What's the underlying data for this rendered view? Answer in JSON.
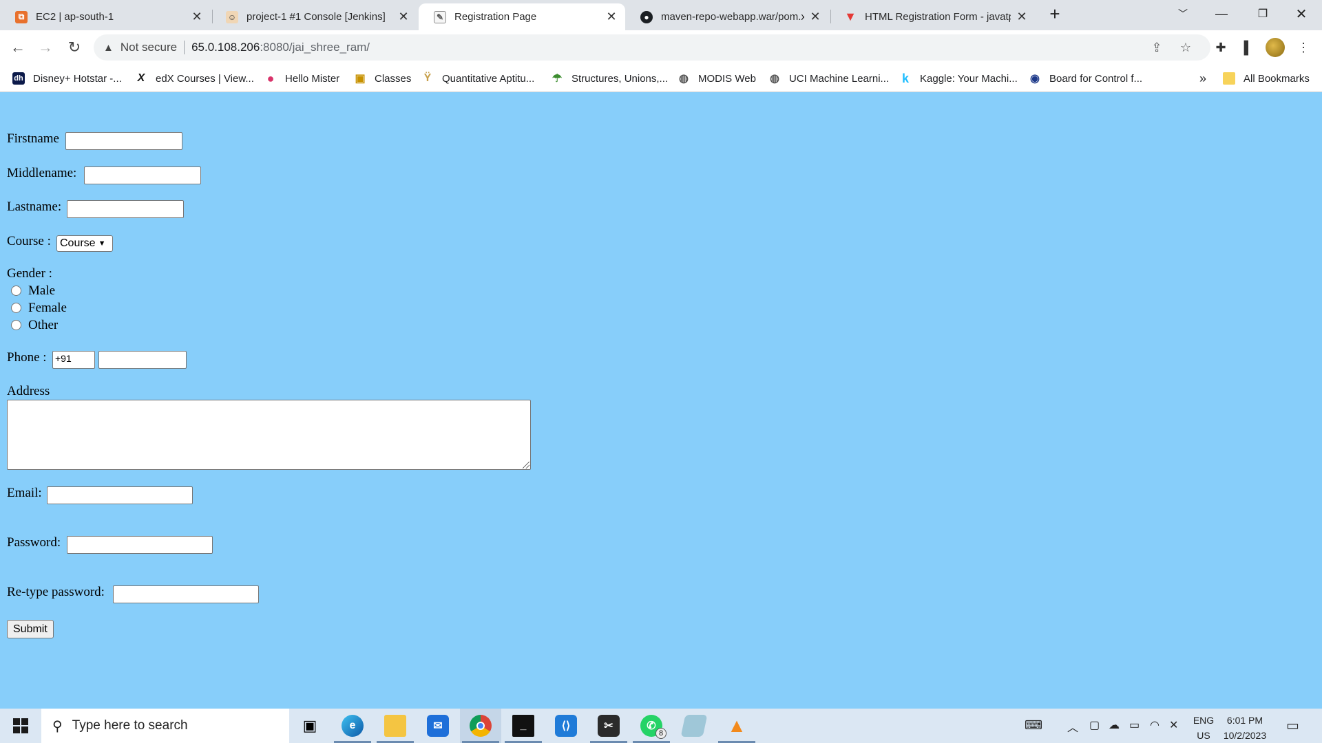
{
  "browser": {
    "tabs": [
      {
        "title": "EC2 | ap-south-1",
        "active": false
      },
      {
        "title": "project-1 #1 Console [Jenkins]",
        "active": false
      },
      {
        "title": "Registration Page",
        "active": true
      },
      {
        "title": "maven-repo-webapp.war/pom.x",
        "active": false
      },
      {
        "title": "HTML Registration Form - javatp",
        "active": false
      }
    ],
    "new_tab": "+",
    "address": {
      "security_label": "Not secure",
      "host": "65.0.108.206",
      "path": ":8080/jai_shree_ram/"
    },
    "bookmarks": [
      {
        "label": "Disney+ Hotstar -...",
        "icon": "hotstar-icon",
        "color": "#0c1a4a",
        "glyph": "dh"
      },
      {
        "label": "edX Courses | View...",
        "icon": "edx-icon",
        "color": "#ffffff",
        "glyph": "X"
      },
      {
        "label": "Hello Mister",
        "icon": "hello-mister-icon",
        "color": "#d9336a",
        "glyph": "●"
      },
      {
        "label": "Classes",
        "icon": "classroom-icon",
        "color": "#f4b400",
        "glyph": "▣"
      },
      {
        "label": "Quantitative Aptitu...",
        "icon": "aptitude-icon",
        "color": "#ffffff",
        "glyph": "Ÿ"
      },
      {
        "label": "Structures, Unions,...",
        "icon": "umbrella-icon",
        "color": "#ffffff",
        "glyph": "☂"
      },
      {
        "label": "MODIS Web",
        "icon": "globe-icon",
        "color": "#ffffff",
        "glyph": "◍"
      },
      {
        "label": "UCI Machine Learni...",
        "icon": "globe-icon",
        "color": "#ffffff",
        "glyph": "◍"
      },
      {
        "label": "Kaggle: Your Machi...",
        "icon": "kaggle-icon",
        "color": "#ffffff",
        "glyph": "k"
      },
      {
        "label": "Board for Control f...",
        "icon": "bcci-icon",
        "color": "#ffffff",
        "glyph": "◉"
      }
    ],
    "bookmarks_overflow": "»",
    "all_bookmarks": "All Bookmarks"
  },
  "form": {
    "firstname_label": "Firstname",
    "middlename_label": "Middlename:",
    "lastname_label": "Lastname:",
    "course_label": "Course :",
    "course_selected": "Course",
    "gender_label": "Gender :",
    "gender_options": [
      "Male",
      "Female",
      "Other"
    ],
    "phone_label": "Phone :",
    "phone_code": "+91",
    "address_label": "Address",
    "email_label": "Email:",
    "password_label": "Password:",
    "retype_label": "Re-type password:",
    "submit_label": "Submit"
  },
  "taskbar": {
    "search_placeholder": "Type here to search",
    "whatsapp_badge": "8",
    "lang_top": "ENG",
    "lang_bottom": "US",
    "time": "6:01 PM",
    "date": "10/2/2023"
  },
  "colors": {
    "page_background": "#87cefa",
    "active_tab": "#ffffff",
    "taskbar": "#dbe7f3"
  }
}
